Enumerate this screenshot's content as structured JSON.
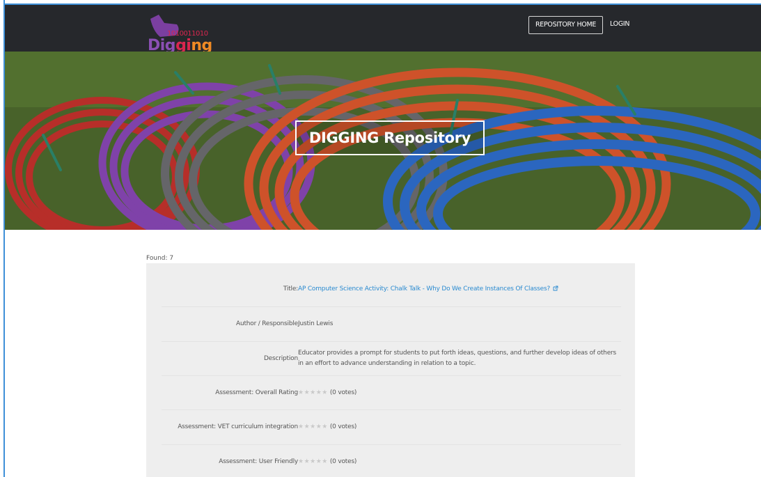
{
  "nav": {
    "logo": {
      "binary": "1010011010",
      "word": "Digging"
    },
    "repository_home": "REPOSITORY HOME",
    "login": "LOGIN"
  },
  "hero": {
    "title": "DIGGING Repository"
  },
  "results": {
    "found": "Found: 7",
    "rows": [
      {
        "label": "Title:",
        "value": "AP Computer Science Activity: Chalk Talk - Why Do We Create Instances Of Classes?"
      },
      {
        "label": "Author / Responsible",
        "value": "Justin Lewis"
      },
      {
        "label": "Description",
        "value": "Educator provides a prompt for students to put forth ideas, questions, and further develop ideas of others in an effort to advance understanding in relation to a topic."
      },
      {
        "label": "Assessment: Overall Rating",
        "stars": "★★★★★",
        "votes": "(0 votes)"
      },
      {
        "label": "Assessment: VET curriculum integration",
        "stars": "★★★★★",
        "votes": "(0 votes)"
      },
      {
        "label": "Assessment: User Friendly",
        "stars": "★★★★★",
        "votes": "(0 votes)"
      }
    ]
  },
  "colors": {
    "navbar": "#26282c",
    "link": "#2a8ad0",
    "panel": "#eeeeee",
    "star_empty": "#c9c9c9",
    "logo_purple": "#7b3fa0",
    "logo_pink": "#d9264f",
    "logo_orange": "#f08a24"
  },
  "icons": {
    "external_link": "external-link-icon",
    "logo": "shovel-icon"
  }
}
